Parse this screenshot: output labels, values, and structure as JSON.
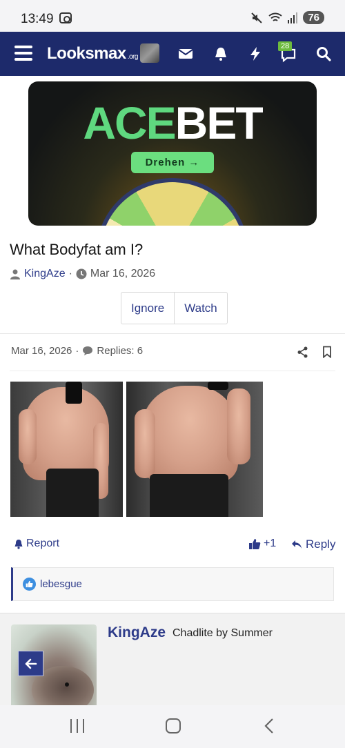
{
  "status_bar": {
    "time": "13:49",
    "battery": "76"
  },
  "navbar": {
    "logo": "Looksmax",
    "logo_suffix": ".org",
    "notifications_badge": "28"
  },
  "ad": {
    "brand_part1": "ACE",
    "brand_part2": "BET",
    "cta": "Drehen →"
  },
  "thread": {
    "title": "What Bodyfat am I?",
    "author": "KingAze",
    "separator": "·",
    "date": "Mar 16, 2026",
    "buttons": [
      "Ignore",
      "Watch"
    ]
  },
  "post": {
    "date": "Mar 16, 2026",
    "separator": "·",
    "replies": "Replies: 6",
    "actions": {
      "report": "Report",
      "like": "+1",
      "reply": "Reply"
    },
    "reactions_user": "lebesgue"
  },
  "next_post": {
    "author": "KingAze",
    "user_title": "Chadlite by Summer"
  },
  "colors": {
    "nav_bg": "#1d2a6b",
    "link": "#2d3b89",
    "accent_green": "#5fd87f"
  }
}
